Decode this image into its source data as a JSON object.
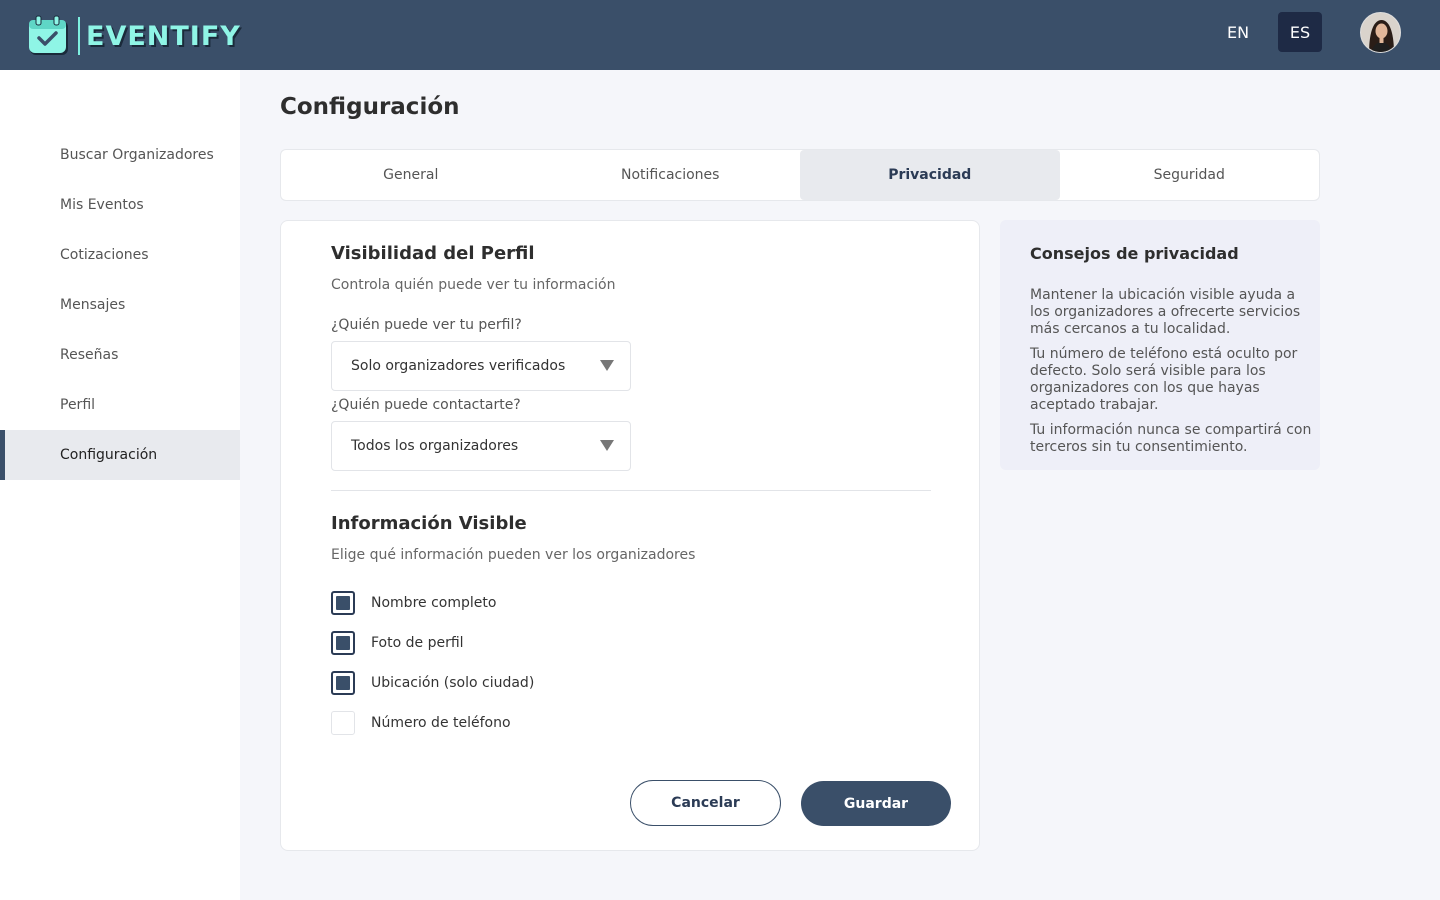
{
  "header": {
    "logo_text": "EVENTIFY",
    "lang_en": "EN",
    "lang_es": "ES",
    "colors": {
      "bar": "#3a4f69",
      "logo_accent": "#8ff5e6",
      "active_lang": "#1e2a45"
    }
  },
  "sidebar": {
    "items": [
      {
        "label": "Buscar Organizadores"
      },
      {
        "label": "Mis Eventos"
      },
      {
        "label": "Cotizaciones"
      },
      {
        "label": "Mensajes"
      },
      {
        "label": "Reseñas"
      },
      {
        "label": "Perfil"
      },
      {
        "label": "Configuración",
        "active": true
      }
    ]
  },
  "main": {
    "title": "Configuración",
    "tabs": [
      {
        "label": "General"
      },
      {
        "label": "Notificaciones"
      },
      {
        "label": "Privacidad",
        "active": true
      },
      {
        "label": "Seguridad"
      }
    ]
  },
  "visibility": {
    "title": "Visibilidad del Perfil",
    "subtitle": "Controla quién puede ver tu información",
    "profile_label": "¿Quién puede ver tu perfil?",
    "profile_value": "Solo organizadores verificados",
    "contact_label": "¿Quién puede contactarte?",
    "contact_value": "Todos los organizadores"
  },
  "info": {
    "title": "Información Visible",
    "subtitle": "Elige qué información pueden ver los organizadores",
    "options": [
      {
        "label": "Nombre completo",
        "checked": true
      },
      {
        "label": "Foto de perfil",
        "checked": true
      },
      {
        "label": "Ubicación (solo ciudad)",
        "checked": true
      },
      {
        "label": "Número de teléfono",
        "checked": false
      }
    ]
  },
  "actions": {
    "cancel": "Cancelar",
    "save": "Guardar"
  },
  "tips": {
    "title": "Consejos de privacidad",
    "items": [
      " Mantener la ubicación visible ayuda a los organizadores a ofrecerte servicios más cercanos a tu localidad.",
      "Tu número de teléfono está oculto por defecto. Solo será visible para los organizadores con los que hayas aceptado trabajar.",
      "Tu información nunca se compartirá con terceros sin tu consentimiento."
    ]
  }
}
